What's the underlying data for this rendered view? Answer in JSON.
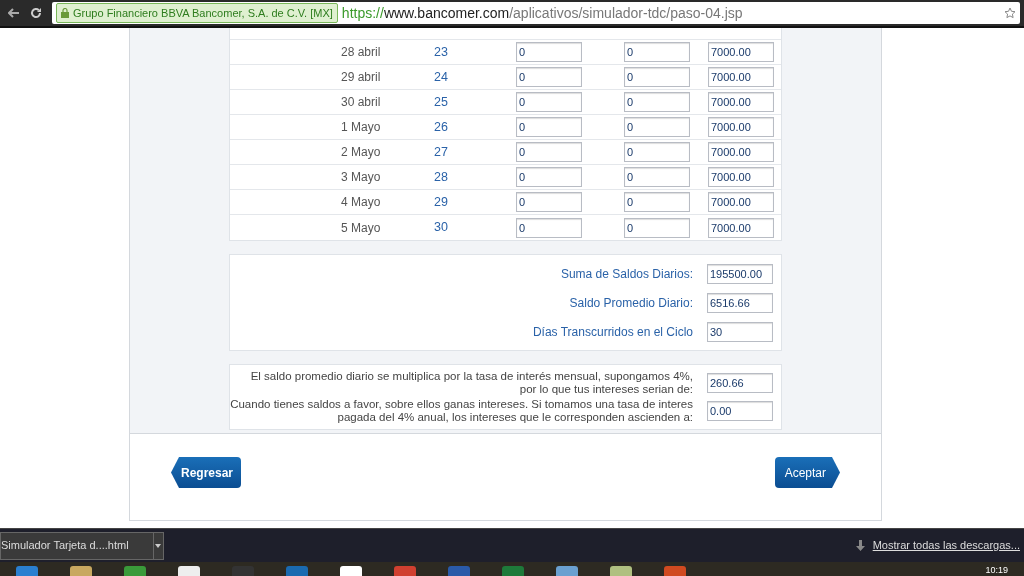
{
  "browser": {
    "ev_badge": "Grupo Financiero BBVA Bancomer, S.A. de C.V. [MX]",
    "url_scheme": "https://",
    "url_host": "www.bancomer.com",
    "url_path": "/aplicativos/simulador-tdc/paso-04.jsp"
  },
  "daily_rows": [
    {
      "date": "28 abril",
      "day": "23",
      "column_3": "0",
      "column_4": "0",
      "column_5": "7000.00"
    },
    {
      "date": "29 abril",
      "day": "24",
      "column_3": "0",
      "column_4": "0",
      "column_5": "7000.00"
    },
    {
      "date": "30 abril",
      "day": "25",
      "column_3": "0",
      "column_4": "0",
      "column_5": "7000.00"
    },
    {
      "date": "1 Mayo",
      "day": "26",
      "column_3": "0",
      "column_4": "0",
      "column_5": "7000.00"
    },
    {
      "date": "2 Mayo",
      "day": "27",
      "column_3": "0",
      "column_4": "0",
      "column_5": "7000.00"
    },
    {
      "date": "3 Mayo",
      "day": "28",
      "column_3": "0",
      "column_4": "0",
      "column_5": "7000.00"
    },
    {
      "date": "4 Mayo",
      "day": "29",
      "column_3": "0",
      "column_4": "0",
      "column_5": "7000.00"
    },
    {
      "date": "5 Mayo",
      "day": "30",
      "column_3": "0",
      "column_4": "0",
      "column_5": "7000.00"
    }
  ],
  "summary": [
    {
      "label": "Suma de Saldos Diarios:",
      "value": "195500.00"
    },
    {
      "label": "Saldo Promedio Diario:",
      "value": "6516.66"
    },
    {
      "label": "Días Transcurridos en el Ciclo",
      "value": "30"
    }
  ],
  "interest": [
    {
      "text": "El saldo promedio diario se multiplica por la tasa de interés mensual, supongamos 4%,\npor lo que tus intereses serian de:",
      "value": "260.66"
    },
    {
      "text": "Cuando tienes saldos a favor, sobre ellos ganas intereses. Si tomamos una tasa de interes\npagada del 4% anual, los intereses que le corresponden ascienden a:",
      "value": "0.00"
    }
  ],
  "buttons": [
    {
      "label": "Regresar",
      "kind": "back"
    },
    {
      "label": "Aceptar",
      "kind": "next"
    }
  ],
  "downloads": {
    "file": "Simulador Tarjeta d....html",
    "show_all": "Mostrar todas las descargas..."
  },
  "taskbar": {
    "clock": "10:19"
  }
}
